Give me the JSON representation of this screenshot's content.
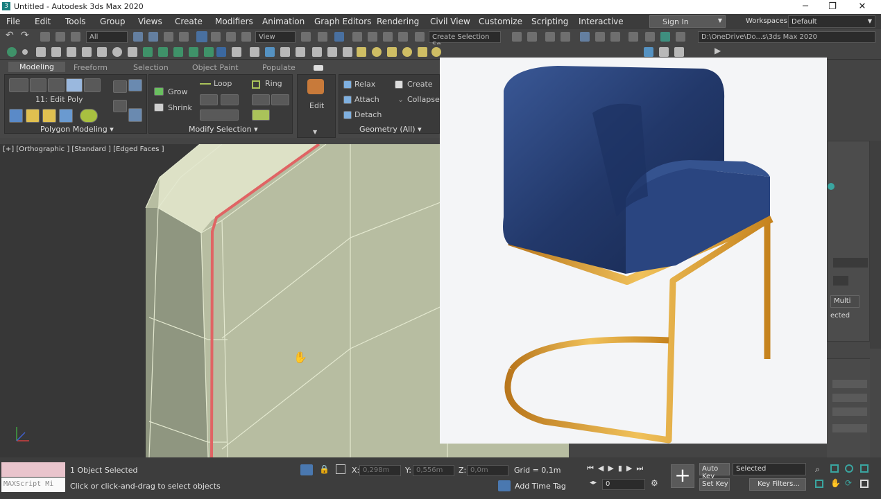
{
  "window": {
    "title": "Untitled - Autodesk 3ds Max 2020",
    "minimize": "─",
    "restore": "❐",
    "close": "✕"
  },
  "menubar": {
    "items": [
      "File",
      "Edit",
      "Tools",
      "Group",
      "Views",
      "Create",
      "Modifiers",
      "Animation",
      "Graph Editors",
      "Rendering",
      "Civil View",
      "Customize",
      "Scripting",
      "Interactive"
    ],
    "sign_in": "Sign In",
    "workspaces_label": "Workspaces:",
    "workspaces_value": "Default"
  },
  "toolbar": {
    "selection_filter": "All",
    "reference_coord": "View",
    "selection_set": "Create Selection Se",
    "project_path": "D:\\OneDrive\\Do...s\\3ds Max 2020"
  },
  "ribbon": {
    "tabs": [
      "Modeling",
      "Freeform",
      "Selection",
      "Object Paint",
      "Populate"
    ],
    "active_tab": "Modeling",
    "edit_poly": "11: Edit Poly",
    "grow": "Grow",
    "shrink": "Shrink",
    "loop": "Loop",
    "ring": "Ring",
    "edit": "Edit",
    "relax": "Relax",
    "create": "Create",
    "attach": "Attach",
    "collapse": "Collapse",
    "detach": "Detach",
    "group_polygon": "Polygon Modeling",
    "group_modify": "Modify Selection",
    "group_geometry": "Geometry (All)"
  },
  "viewport": {
    "label": "[+] [Orthographic ] [Standard ] [Edged Faces ]"
  },
  "cmdpanel": {
    "multi": "Multi",
    "selected": "ected"
  },
  "statusbar": {
    "maxscript": "MAXScript Mi",
    "objects_selected": "1 Object Selected",
    "prompt": "Click or click-and-drag to select objects",
    "x_label": "X:",
    "x_value": "0,298m",
    "y_label": "Y:",
    "y_value": "0,556m",
    "z_label": "Z:",
    "z_value": "0,0m",
    "grid": "Grid = 0,1m",
    "add_time_tag": "Add Time Tag",
    "auto_key": "Auto Key",
    "set_key": "Set Key",
    "key_mode": "Selected",
    "key_filters": "Key Filters...",
    "frame": "0"
  },
  "colors": {
    "mesh_fill": "#b7bda1",
    "mesh_edge": "#e3e8cf",
    "selected_edge": "#e06464",
    "chair_fabric": "#22386a",
    "chair_frame": "#e0a53a"
  }
}
